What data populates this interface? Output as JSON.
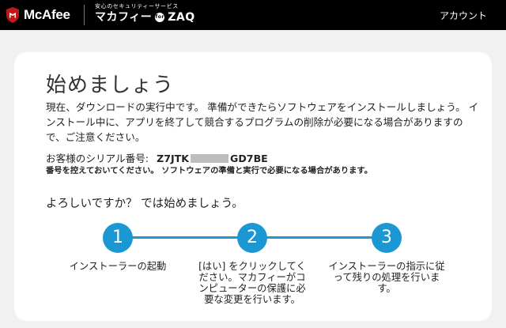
{
  "header": {
    "brand": "McAfee",
    "partner_tagline": "安心のセキュリティーサービス",
    "partner_name": "マカフィー",
    "partner_badge": "for",
    "partner_suffix": "ZAQ",
    "account_label": "アカウント"
  },
  "main": {
    "title": "始めましょう",
    "intro": "現在、ダウンロードの実行中です。 準備ができたらソフトウェアをインストールしましょう。 インストール中に、アプリを終了して競合するプログラムの削除が必要になる場合がありますので、ご注意ください。",
    "serial_label": "お客様のシリアル番号:",
    "serial_prefix": "Z7JTK",
    "serial_suffix": "GD7BE",
    "serial_note": "番号を控えておいてください。 ソフトウェアの準備と実行で必要になる場合があります。",
    "ready_text": "よろしいですか？ では始めましょう。",
    "steps": [
      {
        "number": "1",
        "label": "インストーラーの起動"
      },
      {
        "number": "2",
        "label": "[はい] をクリックしてください。マカフィーがコンピューターの保護に必要な変更を行います。"
      },
      {
        "number": "3",
        "label": "インストーラーの指示に従って残りの処理を行います。"
      }
    ]
  },
  "colors": {
    "accent": "#1b97d4",
    "topbar": "#000000",
    "card": "#ffffff",
    "background": "#f1f1f1",
    "logo_red": "#c01818"
  }
}
